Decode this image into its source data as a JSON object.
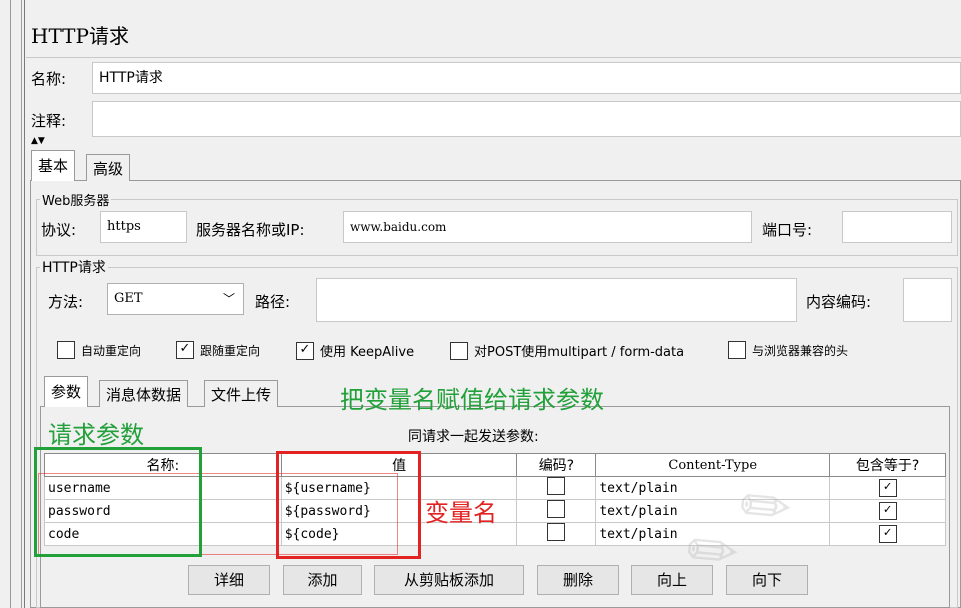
{
  "window": {
    "title": "HTTP请求"
  },
  "name_field": {
    "label": "名称:",
    "value": "HTTP请求"
  },
  "comment_field": {
    "label": "注释:",
    "value": ""
  },
  "tabs": [
    {
      "label": "基本"
    },
    {
      "label": "高级"
    }
  ],
  "web_server": {
    "legend": "Web服务器",
    "protocol_label": "协议:",
    "protocol_value": "https",
    "server_label": "服务器名称或IP:",
    "server_value": "www.baidu.com",
    "port_label": "端口号:",
    "port_value": ""
  },
  "http_request": {
    "legend": "HTTP请求",
    "method_label": "方法:",
    "method_value": "GET",
    "path_label": "路径:",
    "path_value": "",
    "encoding_label": "内容编码:",
    "encoding_value": ""
  },
  "options": [
    {
      "label": "自动重定向",
      "checked": false
    },
    {
      "label": "跟随重定向",
      "checked": true
    },
    {
      "label": "使用 KeepAlive",
      "checked": true
    },
    {
      "label": "对POST使用multipart / form-data",
      "checked": false
    },
    {
      "label": "与浏览器兼容的头",
      "checked": false
    }
  ],
  "param_tabs": [
    {
      "label": "参数"
    },
    {
      "label": "消息体数据"
    },
    {
      "label": "文件上传"
    }
  ],
  "params": {
    "caption": "同请求一起发送参数:",
    "columns": [
      "名称:",
      "值",
      "编码?",
      "Content-Type",
      "包含等于?"
    ],
    "rows": [
      {
        "name": "username",
        "value": "${username}",
        "encode": false,
        "content_type": "text/plain",
        "include_equals": true
      },
      {
        "name": "password",
        "value": "${password}",
        "encode": false,
        "content_type": "text/plain",
        "include_equals": true
      },
      {
        "name": "code",
        "value": "${code}",
        "encode": false,
        "content_type": "text/plain",
        "include_equals": true
      }
    ]
  },
  "buttons": {
    "detail": "详细",
    "add": "添加",
    "paste": "从剪贴板添加",
    "delete": "删除",
    "up": "向上",
    "down": "向下"
  },
  "annotations": {
    "assign_note": "把变量名赋值给请求参数",
    "request_params": "请求参数",
    "variable_name": "变量名",
    "annotation_green": "#22a03a",
    "annotation_red": "#e32222"
  }
}
